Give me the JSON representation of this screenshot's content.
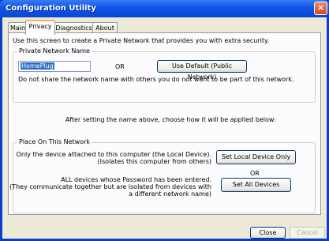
{
  "window": {
    "title": "Configuration Utility",
    "close_glyph": "×"
  },
  "tabs": [
    {
      "label": "Main"
    },
    {
      "label": "Privacy"
    },
    {
      "label": "Diagnostics"
    },
    {
      "label": "About"
    }
  ],
  "privacy": {
    "intro": "Use this screen to create a Private Network that provides you with extra security.",
    "network_group": {
      "title": "Private Network Name",
      "name_value": "HomePlug",
      "or_label": "OR",
      "default_button": "Use Default (Public Network)",
      "warning": "Do not share the network name with others you do not want to be part of this network."
    },
    "after_text": "After setting the name above, choose how it will be applied below:",
    "place_group": {
      "title": "Place On This Network",
      "local_line1": "Only the device attached to this computer (the Local Device).",
      "local_line2": "(Isolates this computer from others)",
      "local_button": "Set Local Device Only",
      "or_label": "OR",
      "all_line1": "ALL devices whose Password has been entered.",
      "all_line2": "(They communicate together but are isolated from devices with",
      "all_line3": "a different network name)",
      "all_button": "Set All Devices"
    }
  },
  "footer": {
    "close_button": "Close",
    "cancel_button": "Cancel"
  }
}
